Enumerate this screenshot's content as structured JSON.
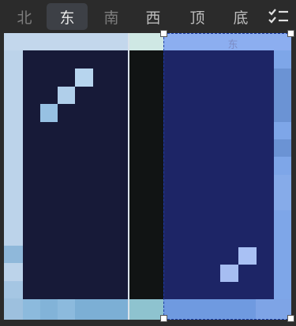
{
  "tabs": [
    {
      "label": "北",
      "state": "dim"
    },
    {
      "label": "东",
      "state": "active"
    },
    {
      "label": "南",
      "state": "dim"
    },
    {
      "label": "西",
      "state": "normal"
    },
    {
      "label": "顶",
      "state": "normal"
    },
    {
      "label": "底",
      "state": "normal"
    }
  ],
  "toolbar": {
    "list_icon": "checklist-icon"
  },
  "canvas": {
    "selected_face_label": "东",
    "colors": {
      "left_face_border": "#bcd3ea",
      "left_face_inner": "#171a38",
      "middle_strip": "#111414",
      "right_face_border": "#7ea6e8",
      "right_face_inner": "#1d2566",
      "highlight": "#b7d5ee",
      "selection": "#1e3ea8"
    }
  }
}
